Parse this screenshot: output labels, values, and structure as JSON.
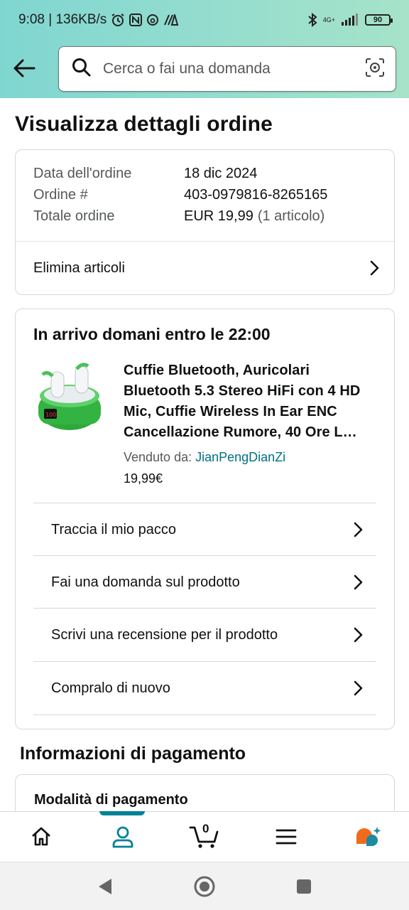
{
  "status_bar": {
    "time_speed": "9:08 | 136KB/s",
    "network": "4G+",
    "battery": "90"
  },
  "search": {
    "placeholder": "Cerca o fai una domanda"
  },
  "page": {
    "title": "Visualizza dettagli ordine"
  },
  "order_info": {
    "date_label": "Data dell'ordine",
    "date_value": "18 dic 2024",
    "number_label": "Ordine #",
    "number_value": "403-0979816-8265165",
    "total_label": "Totale ordine",
    "total_value": "EUR 19,99",
    "total_count": "(1 articolo)",
    "delete_items": "Elimina articoli"
  },
  "shipment": {
    "arrival": "In arrivo domani entro le 22:00",
    "product_title": "Cuffie Bluetooth, Auricolari Bluetooth 5.3 Stereo HiFi con 4 HD Mic, Cuffie Wireless In Ear ENC Cancellazione Rumore, 40 Ore L…",
    "seller_label": "Venduto da:",
    "seller_name": "JianPengDianZi",
    "price": "19,99€",
    "actions": [
      "Traccia il mio pacco",
      "Fai una domanda sul prodotto",
      "Scrivi una recensione per il prodotto",
      "Compralo di nuovo"
    ]
  },
  "payment": {
    "section_title": "Informazioni di pagamento",
    "mode_label": "Modalità di pagamento"
  },
  "bottom_nav": {
    "cart_count": "0"
  },
  "colors": {
    "accent": "#008296",
    "link": "#007185",
    "rufus": "#f26b1d"
  }
}
